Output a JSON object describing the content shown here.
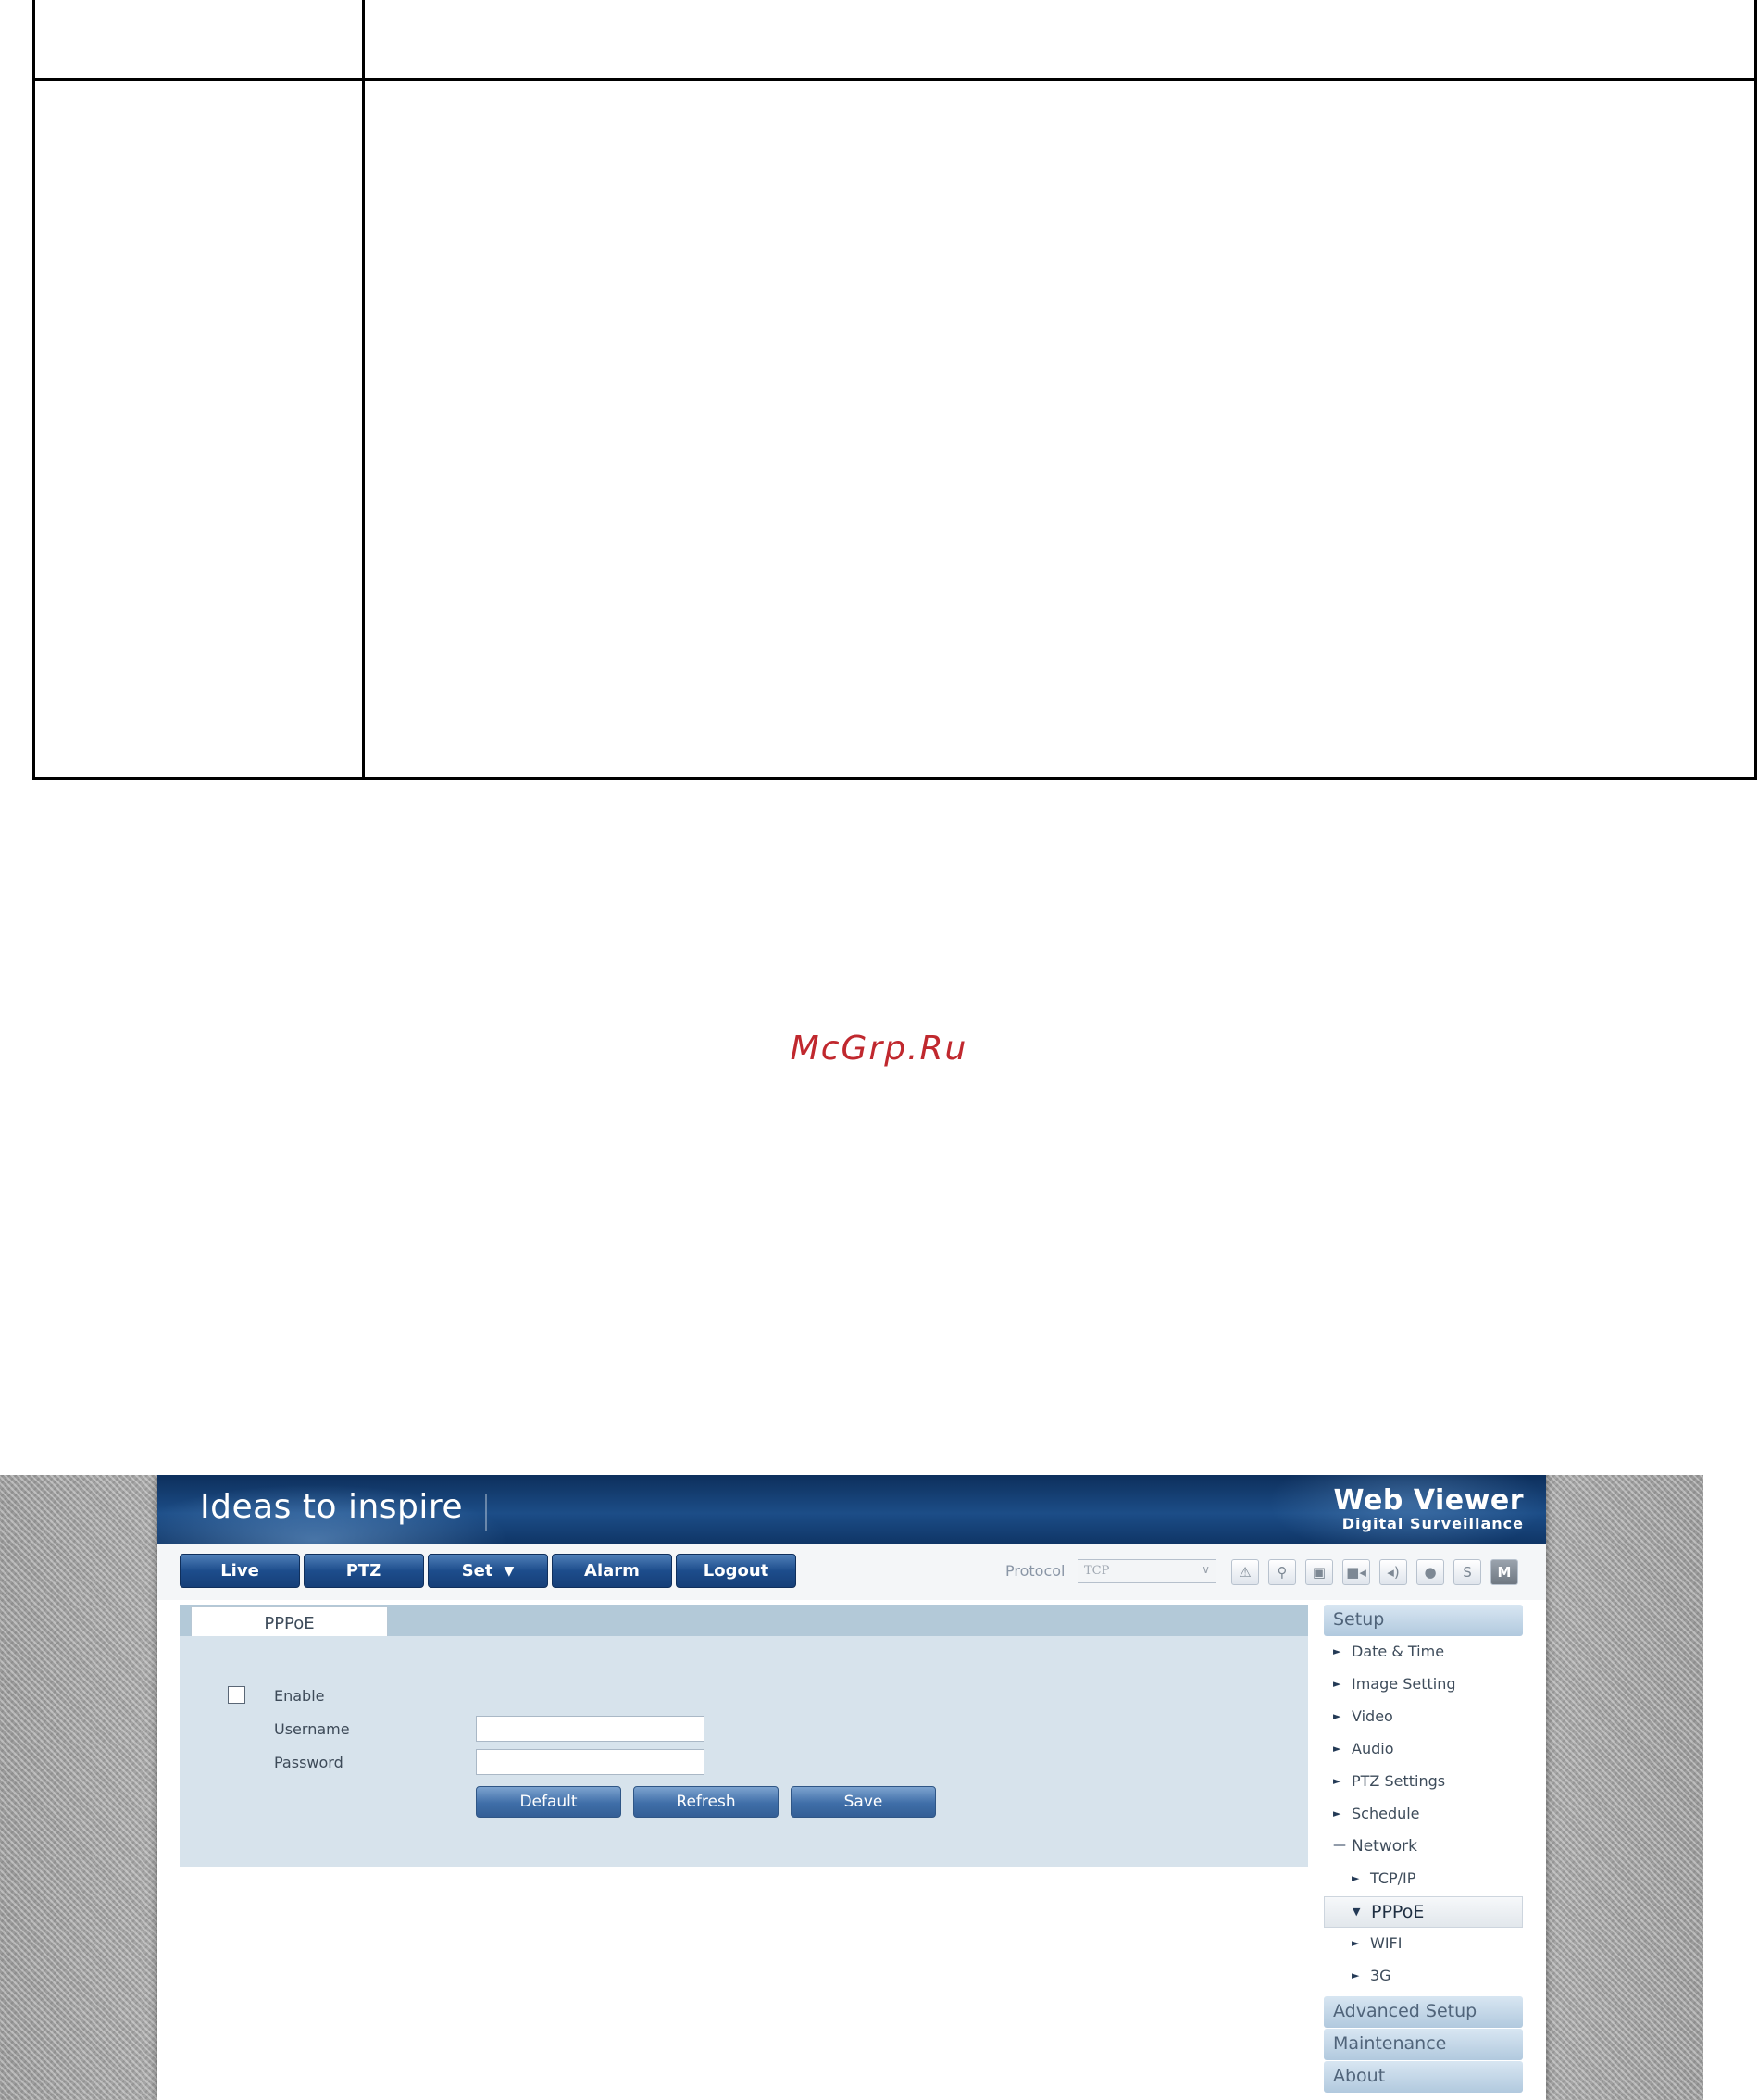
{
  "watermark": "McGrp.Ru",
  "app": {
    "tagline": "Ideas to inspire",
    "brand_title": "Web Viewer",
    "brand_subtitle": "Digital Surveillance",
    "nav": [
      "Live",
      "PTZ",
      "Set",
      "Alarm",
      "Logout"
    ],
    "set_caret": "▼",
    "protocol_label": "Protocol",
    "protocol_value": "TCP",
    "toolbar_icons": [
      {
        "name": "alarm-warning-icon",
        "glyph": "⚠"
      },
      {
        "name": "zoom-icon",
        "glyph": "🔍"
      },
      {
        "name": "snapshot-icon",
        "glyph": "▣"
      },
      {
        "name": "record-icon",
        "glyph": "■◂"
      },
      {
        "name": "speaker-icon",
        "glyph": "◂)"
      },
      {
        "name": "microphone-icon",
        "glyph": "ǐ"
      },
      {
        "name": "stream-s-icon",
        "glyph": "S"
      },
      {
        "name": "stream-m-icon",
        "glyph": "M"
      }
    ],
    "panel": {
      "tab": "PPPoE",
      "enable_label": "Enable",
      "username_label": "Username",
      "password_label": "Password",
      "username_value": "",
      "password_value": "",
      "buttons": [
        "Default",
        "Refresh",
        "Save"
      ]
    },
    "sidemenu": {
      "setup": "Setup",
      "items": [
        {
          "marker": "►",
          "label": "Date & Time"
        },
        {
          "marker": "►",
          "label": "Image Setting"
        },
        {
          "marker": "►",
          "label": "Video"
        },
        {
          "marker": "►",
          "label": "Audio"
        },
        {
          "marker": "►",
          "label": "PTZ Settings"
        },
        {
          "marker": "►",
          "label": "Schedule"
        },
        {
          "marker": "—",
          "label": "Network"
        },
        {
          "marker": "►",
          "label": "TCP/IP"
        },
        {
          "marker": "▼",
          "label": "PPPoE"
        },
        {
          "marker": "►",
          "label": "WIFI"
        },
        {
          "marker": "►",
          "label": "3G"
        }
      ],
      "advanced": "Advanced Setup",
      "maintenance": "Maintenance",
      "about": "About"
    }
  }
}
